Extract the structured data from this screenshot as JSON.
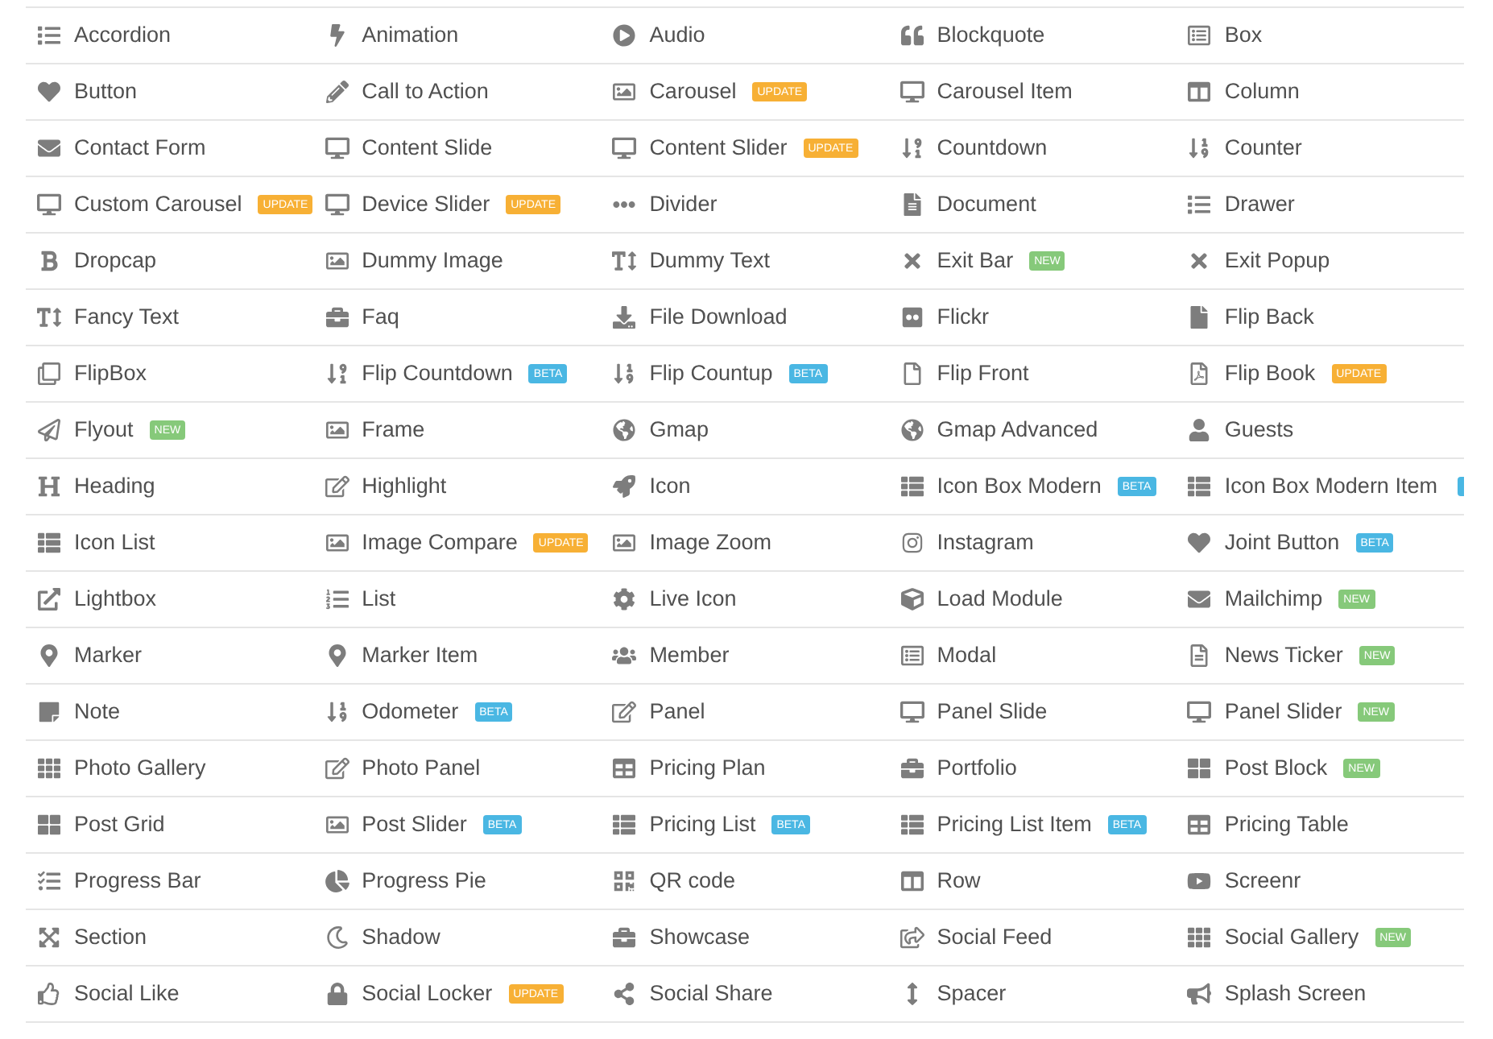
{
  "modules": [
    {
      "name": "Accordion"
    },
    {
      "name": "Animation"
    },
    {
      "name": "Audio"
    },
    {
      "name": "Blockquote"
    },
    {
      "name": "Box"
    },
    {
      "name": "Button"
    },
    {
      "name": "Call to Action"
    },
    {
      "name": "Carousel",
      "badge": {
        "label": "UPDATE",
        "color": "#f7b035"
      }
    },
    {
      "name": "Carousel Item"
    },
    {
      "name": "Column"
    },
    {
      "name": "Contact Form"
    },
    {
      "name": "Content Slide"
    },
    {
      "name": "Content Slider",
      "badge": {
        "label": "UPDATE",
        "color": "#f7b035"
      }
    },
    {
      "name": "Countdown"
    },
    {
      "name": "Counter"
    },
    {
      "name": "Custom Carousel",
      "badge": {
        "label": "UPDATE",
        "color": "#f7b035"
      }
    },
    {
      "name": "Device Slider",
      "badge": {
        "label": "UPDATE",
        "color": "#f7b035"
      }
    },
    {
      "name": "Divider"
    },
    {
      "name": "Document"
    },
    {
      "name": "Drawer"
    },
    {
      "name": "Dropcap"
    },
    {
      "name": "Dummy Image"
    },
    {
      "name": "Dummy Text"
    },
    {
      "name": "Exit Bar",
      "badge": {
        "label": "NEW",
        "color": "#86c97a"
      }
    },
    {
      "name": "Exit Popup"
    },
    {
      "name": "Fancy Text"
    },
    {
      "name": "Faq"
    },
    {
      "name": "File Download"
    },
    {
      "name": "Flickr"
    },
    {
      "name": "Flip Back"
    },
    {
      "name": "FlipBox"
    },
    {
      "name": "Flip Countdown",
      "badge": {
        "label": "BETA",
        "color": "#4ab7e3"
      }
    },
    {
      "name": "Flip Countup",
      "badge": {
        "label": "BETA",
        "color": "#4ab7e3"
      }
    },
    {
      "name": "Flip Front"
    },
    {
      "name": "Flip Book",
      "badge": {
        "label": "UPDATE",
        "color": "#f7b035"
      }
    },
    {
      "name": "Flyout",
      "badge": {
        "label": "NEW",
        "color": "#86c97a"
      }
    },
    {
      "name": "Frame"
    },
    {
      "name": "Gmap"
    },
    {
      "name": "Gmap Advanced"
    },
    {
      "name": "Guests"
    },
    {
      "name": "Heading"
    },
    {
      "name": "Highlight"
    },
    {
      "name": "Icon"
    },
    {
      "name": "Icon Box Modern",
      "badge": {
        "label": "BETA",
        "color": "#4ab7e3"
      }
    },
    {
      "name": "Icon Box Modern Item",
      "badge": {
        "color": "#4ab7e3"
      }
    },
    {
      "name": "Icon List"
    },
    {
      "name": "Image Compare",
      "badge": {
        "label": "UPDATE",
        "color": "#f7b035"
      }
    },
    {
      "name": "Image Zoom"
    },
    {
      "name": "Instagram"
    },
    {
      "name": "Joint Button",
      "badge": {
        "label": "BETA",
        "color": "#4ab7e3"
      }
    },
    {
      "name": "Lightbox"
    },
    {
      "name": "List"
    },
    {
      "name": "Live Icon"
    },
    {
      "name": "Load Module"
    },
    {
      "name": "Mailchimp",
      "badge": {
        "label": "NEW",
        "color": "#86c97a"
      }
    },
    {
      "name": "Marker"
    },
    {
      "name": "Marker Item"
    },
    {
      "name": "Member"
    },
    {
      "name": "Modal"
    },
    {
      "name": "News Ticker",
      "badge": {
        "label": "NEW",
        "color": "#86c97a"
      }
    },
    {
      "name": "Note"
    },
    {
      "name": "Odometer",
      "badge": {
        "label": "BETA",
        "color": "#4ab7e3"
      }
    },
    {
      "name": "Panel"
    },
    {
      "name": "Panel Slide"
    },
    {
      "name": "Panel Slider",
      "badge": {
        "label": "NEW",
        "color": "#86c97a"
      }
    },
    {
      "name": "Photo Gallery"
    },
    {
      "name": "Photo Panel"
    },
    {
      "name": "Pricing Plan"
    },
    {
      "name": "Portfolio"
    },
    {
      "name": "Post Block",
      "badge": {
        "label": "NEW",
        "color": "#86c97a"
      }
    },
    {
      "name": "Post Grid"
    },
    {
      "name": "Post Slider",
      "badge": {
        "label": "BETA",
        "color": "#4ab7e3"
      }
    },
    {
      "name": "Pricing List",
      "badge": {
        "label": "BETA",
        "color": "#4ab7e3"
      }
    },
    {
      "name": "Pricing List Item",
      "badge": {
        "label": "BETA",
        "color": "#4ab7e3"
      }
    },
    {
      "name": "Pricing Table"
    },
    {
      "name": "Progress Bar"
    },
    {
      "name": "Progress Pie"
    },
    {
      "name": "QR code"
    },
    {
      "name": "Row"
    },
    {
      "name": "Screenr"
    },
    {
      "name": "Section"
    },
    {
      "name": "Shadow"
    },
    {
      "name": "Showcase"
    },
    {
      "name": "Social Feed"
    },
    {
      "name": "Social Gallery",
      "badge": {
        "label": "NEW",
        "color": "#86c97a"
      }
    },
    {
      "name": "Social Like"
    },
    {
      "name": "Social Locker",
      "badge": {
        "label": "UPDATE",
        "color": "#f7b035"
      }
    },
    {
      "name": "Social Share"
    },
    {
      "name": "Spacer"
    },
    {
      "name": "Splash Screen"
    }
  ]
}
